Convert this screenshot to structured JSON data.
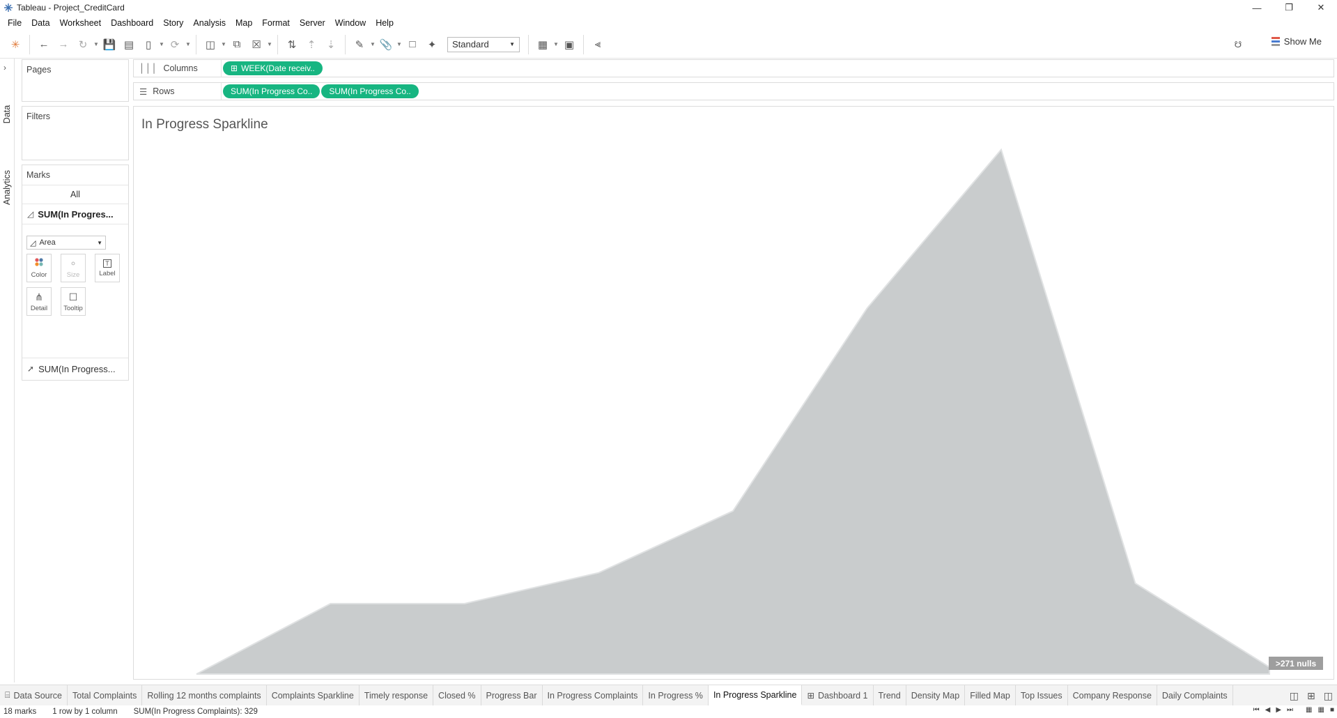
{
  "window": {
    "title": "Tableau - Project_CreditCard"
  },
  "menu": [
    "File",
    "Data",
    "Worksheet",
    "Dashboard",
    "Story",
    "Analysis",
    "Map",
    "Format",
    "Server",
    "Window",
    "Help"
  ],
  "toolbar": {
    "fit_select": "Standard",
    "show_me": "Show Me"
  },
  "side_tabs": {
    "data": "Data",
    "analytics": "Analytics"
  },
  "cards": {
    "pages": "Pages",
    "filters": "Filters",
    "marks": "Marks",
    "marks_all": "All",
    "marks_measure": "SUM(In Progres...",
    "mark_type": "Area",
    "buttons": {
      "color": "Color",
      "size": "Size",
      "label": "Label",
      "detail": "Detail",
      "tooltip": "Tooltip"
    },
    "marks_second": "SUM(In Progress..."
  },
  "shelves": {
    "columns_label": "Columns",
    "rows_label": "Rows",
    "columns_pills": [
      "WEEK(Date receiv.."
    ],
    "rows_pills": [
      "SUM(In Progress Co..",
      "SUM(In Progress Co.."
    ]
  },
  "sheet": {
    "title": "In Progress Sparkline",
    "nulls_badge": ">271 nulls"
  },
  "chart_data": {
    "type": "area",
    "x": [
      1,
      2,
      3,
      4,
      5,
      6,
      7,
      8,
      9
    ],
    "values": [
      0,
      8,
      8,
      11.5,
      18.5,
      41.5,
      59.5,
      10.3,
      0.8
    ],
    "ylim": [
      0,
      62
    ],
    "color": "#c9cccd",
    "title": "In Progress Sparkline",
    "grid": false
  },
  "sheet_tabs": [
    {
      "label": "Data Source",
      "icon": "database-icon"
    },
    {
      "label": "Total Complaints"
    },
    {
      "label": "Rolling 12 months complaints"
    },
    {
      "label": "Complaints Sparkline"
    },
    {
      "label": "Timely response"
    },
    {
      "label": "Closed %"
    },
    {
      "label": "Progress Bar"
    },
    {
      "label": "In Progress Complaints"
    },
    {
      "label": "In Progress %"
    },
    {
      "label": "In Progress Sparkline",
      "active": true
    },
    {
      "label": "Dashboard 1",
      "icon": "dashboard-icon"
    },
    {
      "label": "Trend"
    },
    {
      "label": "Density Map"
    },
    {
      "label": "Filled Map"
    },
    {
      "label": "Top Issues"
    },
    {
      "label": "Company Response"
    },
    {
      "label": "Daily Complaints"
    }
  ],
  "status": {
    "marks": "18 marks",
    "layout": "1 row by 1 column",
    "sum": "SUM(In Progress Complaints): 329"
  }
}
